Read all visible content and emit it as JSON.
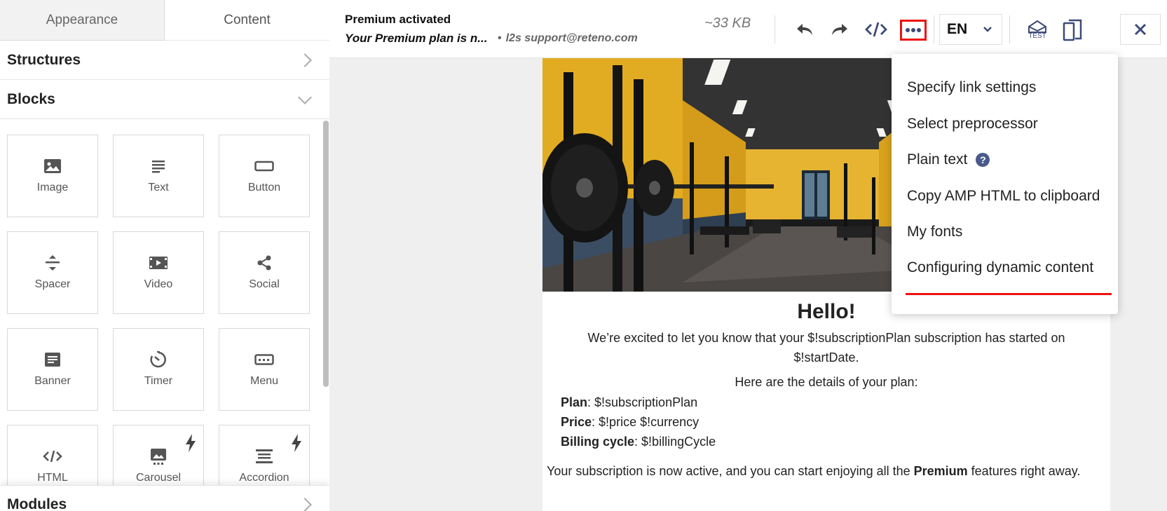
{
  "sidebar": {
    "tabs": [
      {
        "label": "Appearance",
        "active": false
      },
      {
        "label": "Content",
        "active": true
      }
    ],
    "structures_label": "Structures",
    "blocks_label": "Blocks",
    "modules_label": "Modules",
    "blocks": [
      {
        "label": "Image",
        "icon": "image-icon"
      },
      {
        "label": "Text",
        "icon": "text-icon"
      },
      {
        "label": "Button",
        "icon": "button-icon"
      },
      {
        "label": "Spacer",
        "icon": "spacer-icon"
      },
      {
        "label": "Video",
        "icon": "video-icon"
      },
      {
        "label": "Social",
        "icon": "share-icon"
      },
      {
        "label": "Banner",
        "icon": "banner-icon"
      },
      {
        "label": "Timer",
        "icon": "timer-icon"
      },
      {
        "label": "Menu",
        "icon": "menu-icon"
      },
      {
        "label": "HTML",
        "icon": "code-icon"
      },
      {
        "label": "Carousel",
        "icon": "carousel-icon",
        "amp": true
      },
      {
        "label": "Accordion",
        "icon": "accordion-icon",
        "amp": true
      }
    ]
  },
  "toolbar": {
    "subject": "Premium activated",
    "preheader": "Your Premium plan is n...",
    "sender": "l2s support@reteno.com",
    "size": "~33 KB",
    "language": "EN",
    "test_label": "TEST",
    "colors": {
      "highlight": "#ee1111"
    }
  },
  "email": {
    "hello": "Hello!",
    "intro": "We’re excited to let you know that your $!subscriptionPlan subscription has started on $!startDate.",
    "details_title": "Here are the details of your plan:",
    "plan_label": "Plan",
    "plan_value": ": $!subscriptionPlan",
    "price_label": "Price",
    "price_value": ": $!price $!currency",
    "billing_label": "Billing cycle",
    "billing_value": ": $!billingCycle",
    "active_pre": "Your subscription is now active, and you can start enjoying all the ",
    "active_bold": "Premium",
    "active_post": " features right away."
  },
  "more_menu": {
    "items": [
      "Specify link settings",
      "Select preprocessor",
      "Plain text",
      "Copy AMP HTML to clipboard",
      "My fonts",
      "Configuring dynamic content"
    ],
    "help_glyph": "?"
  }
}
